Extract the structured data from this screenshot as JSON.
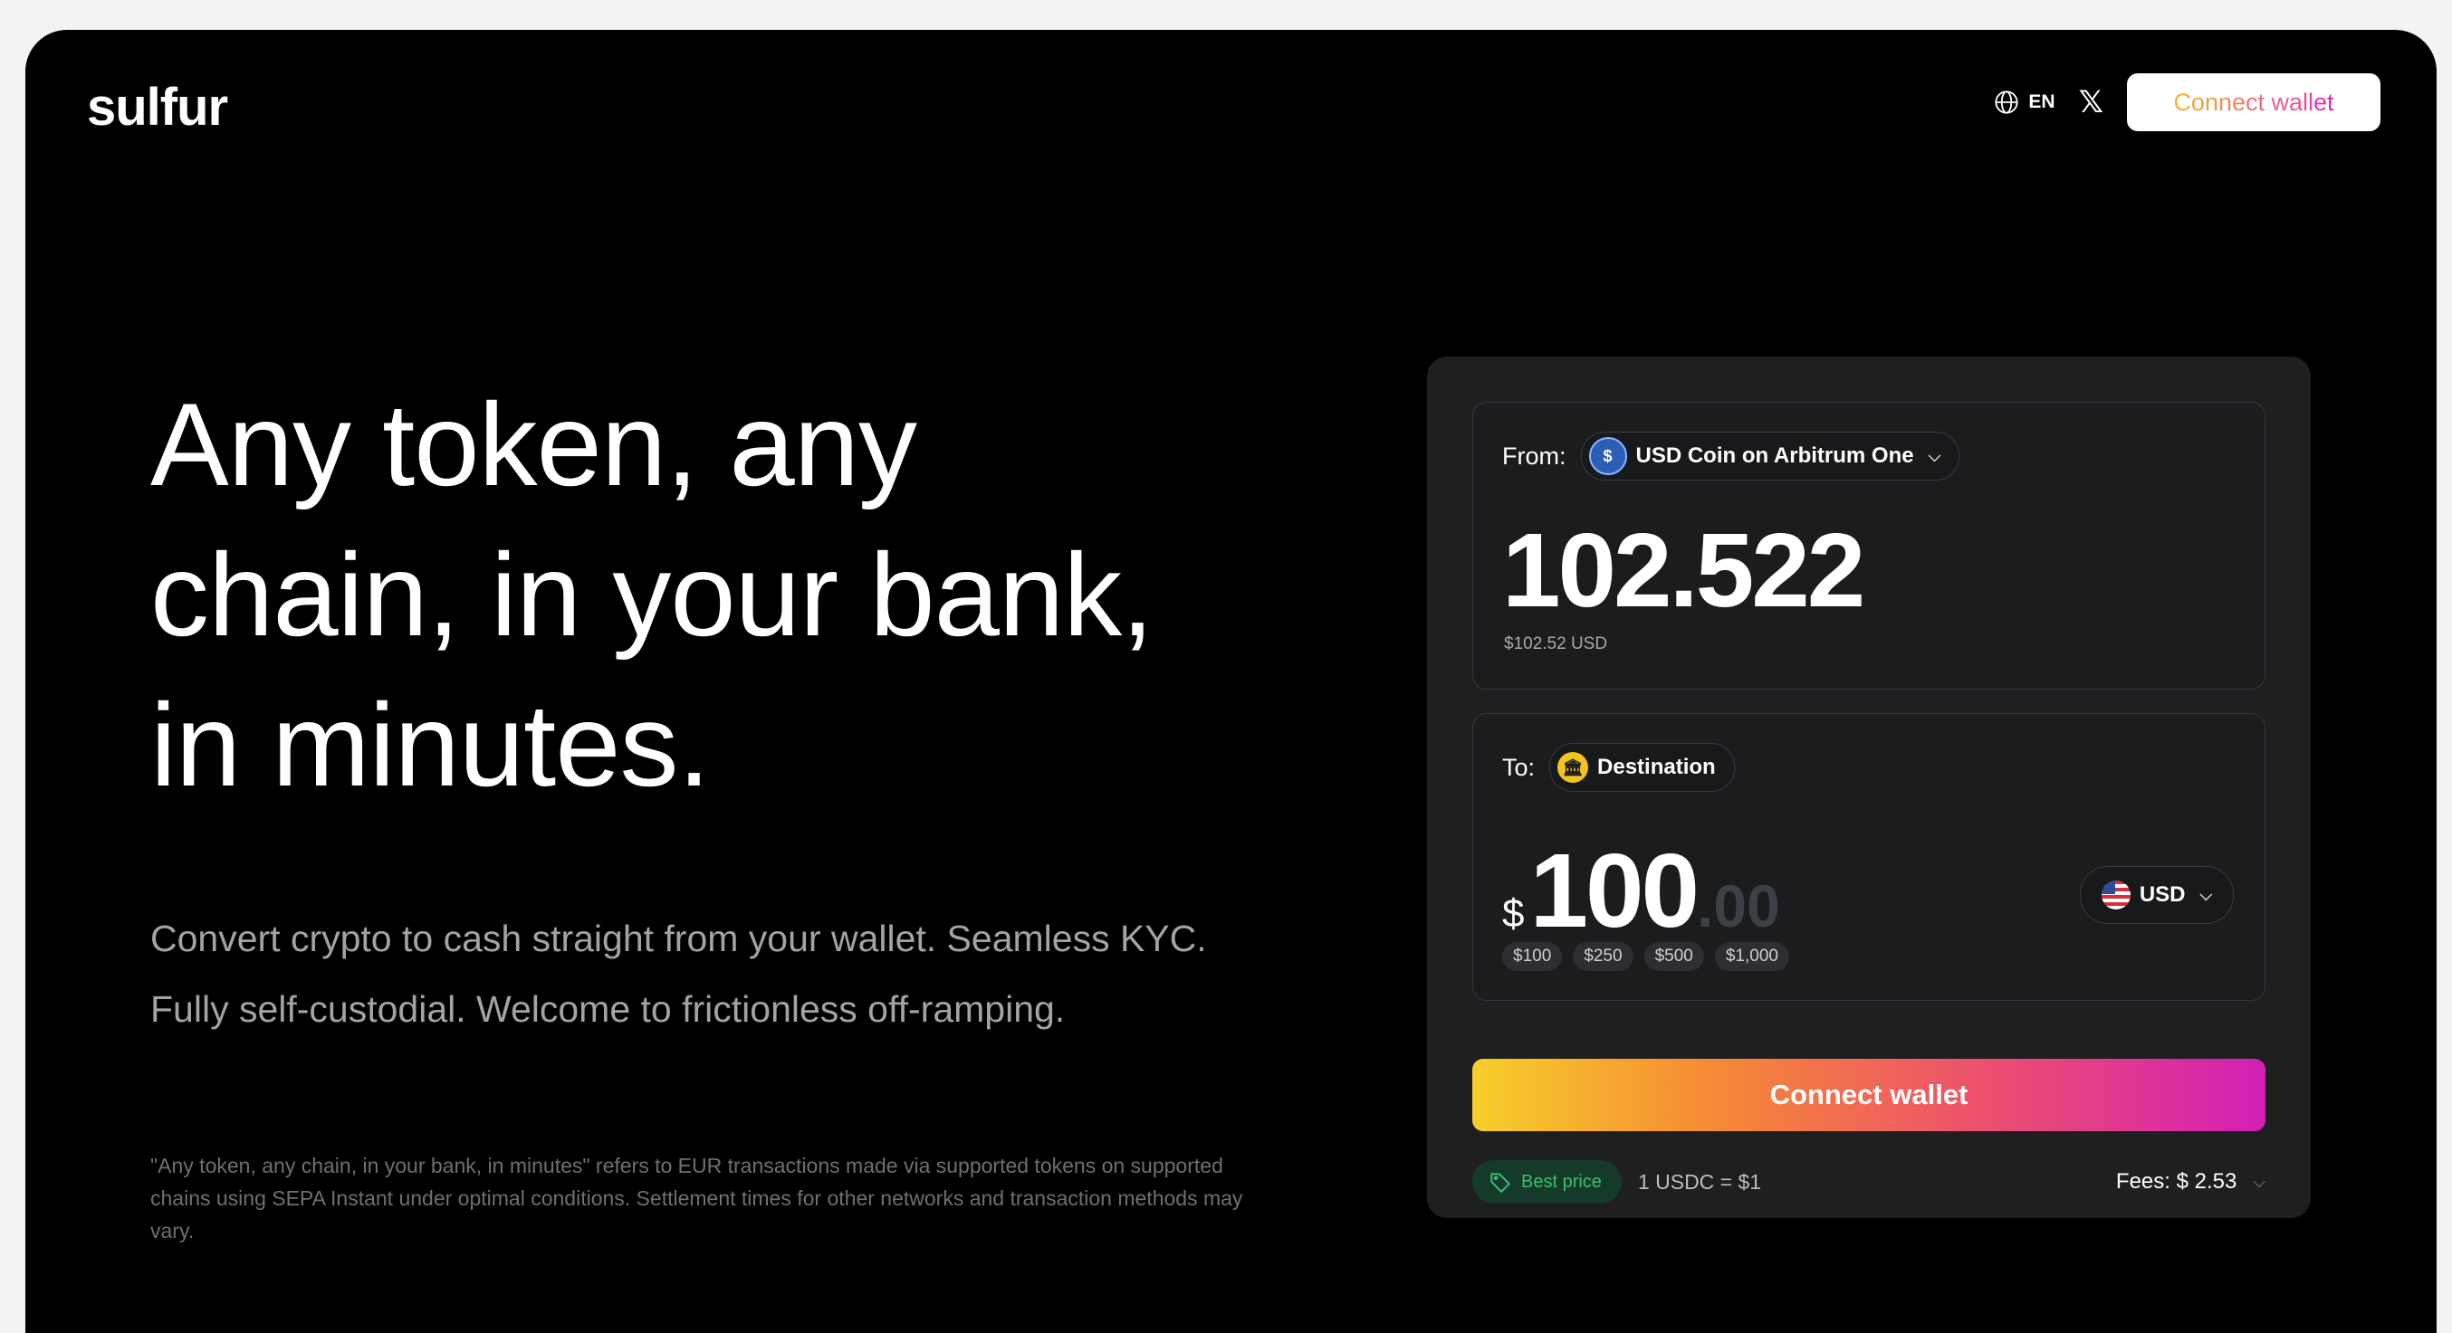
{
  "brand": {
    "logo": "sulfur"
  },
  "nav": {
    "language": "EN",
    "social_icon": "x-logo-icon",
    "connect_wallet": "Connect wallet"
  },
  "hero": {
    "line1": "Any token, any",
    "line2": "chain, in your bank,",
    "line3": "in minutes.",
    "subtitle_line1": "Convert crypto to cash straight from your wallet. Seamless KYC.",
    "subtitle_line2": "Fully self-custodial. Welcome to frictionless off-ramping.",
    "disclaimer": "\"Any token, any chain, in your bank, in minutes\" refers to EUR transactions made via supported tokens on supported chains using SEPA Instant under optimal conditions. Settlement times for other networks and transaction methods may vary."
  },
  "widget": {
    "from": {
      "label": "From:",
      "token": "USD Coin on Arbitrum One",
      "amount": "102.522",
      "amount_usd": "$102.52 USD"
    },
    "to": {
      "label": "To:",
      "destination": "Destination",
      "currency_symbol": "$",
      "amount": "100",
      "cents": ".00",
      "currency": "USD",
      "quick_amounts": [
        "$100",
        "$250",
        "$500",
        "$1,000"
      ]
    },
    "cta": "Connect wallet",
    "best_price": "Best price",
    "rate": "1 USDC = $1",
    "fees": "Fees: $ 2.53"
  },
  "colors": {
    "background": "#000000",
    "card": "#1e1f21",
    "gradient_start": "#f6cf2a",
    "gradient_end": "#d21fb6",
    "best_price": "#38c172"
  }
}
